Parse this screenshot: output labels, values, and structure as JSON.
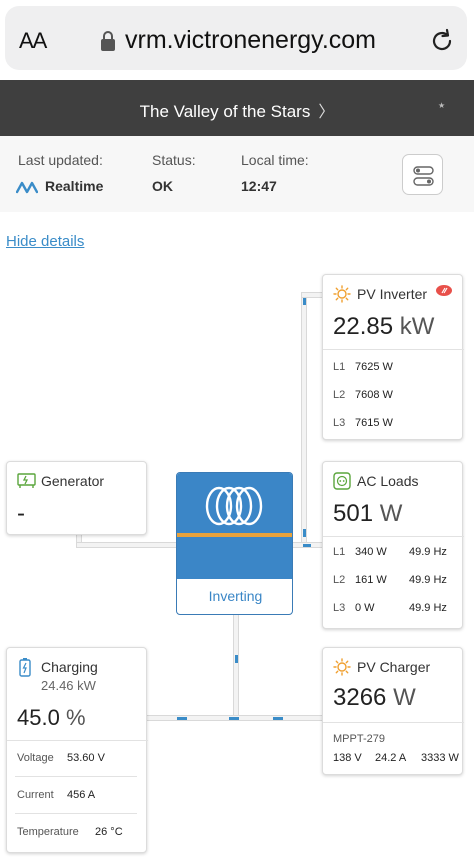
{
  "browser": {
    "text_size_label": "AA",
    "url": "vrm.victronenergy.com"
  },
  "site": {
    "title": "The Valley of the Stars",
    "title_chevron": "〉"
  },
  "status": {
    "last_updated_label": "Last updated:",
    "last_updated_value": "Realtime",
    "status_label": "Status:",
    "status_value": "OK",
    "local_time_label": "Local time:",
    "local_time_value": "12:47"
  },
  "hide_details_label": "Hide details",
  "pv_inverter": {
    "title": "PV Inverter",
    "value": "22.85",
    "unit": "kW",
    "phases": [
      {
        "label": "L1",
        "value": "7625 W"
      },
      {
        "label": "L2",
        "value": "7608 W"
      },
      {
        "label": "L3",
        "value": "7615 W"
      }
    ]
  },
  "generator": {
    "title": "Generator",
    "value": "-"
  },
  "ac_loads": {
    "title": "AC Loads",
    "value": "501",
    "unit": "W",
    "phases": [
      {
        "label": "L1",
        "value": "340 W",
        "freq": "49.9 Hz"
      },
      {
        "label": "L2",
        "value": "161 W",
        "freq": "49.9 Hz"
      },
      {
        "label": "L3",
        "value": "0 W",
        "freq": "49.9 Hz"
      }
    ]
  },
  "inverter": {
    "state": "Inverting"
  },
  "battery": {
    "title": "Charging",
    "power": "24.46 kW",
    "value": "45.0",
    "unit": "%",
    "voltage_label": "Voltage",
    "voltage_value": "53.60 V",
    "current_label": "Current",
    "current_value": "456 A",
    "temperature_label": "Temperature",
    "temperature_value": "26 °C"
  },
  "pv_charger": {
    "title": "PV Charger",
    "value": "3266",
    "unit": "W",
    "device": "MPPT-279",
    "voltage": "138 V",
    "current": "24.2 A",
    "power": "3333 W"
  },
  "colors": {
    "accent_blue": "#3a8cc8",
    "victron_blue": "#3b86c7",
    "stripe_orange": "#e8a23b",
    "title_bar": "#3f3f3f",
    "sun_orange": "#f0a030",
    "green_icon": "#5aa53c"
  }
}
